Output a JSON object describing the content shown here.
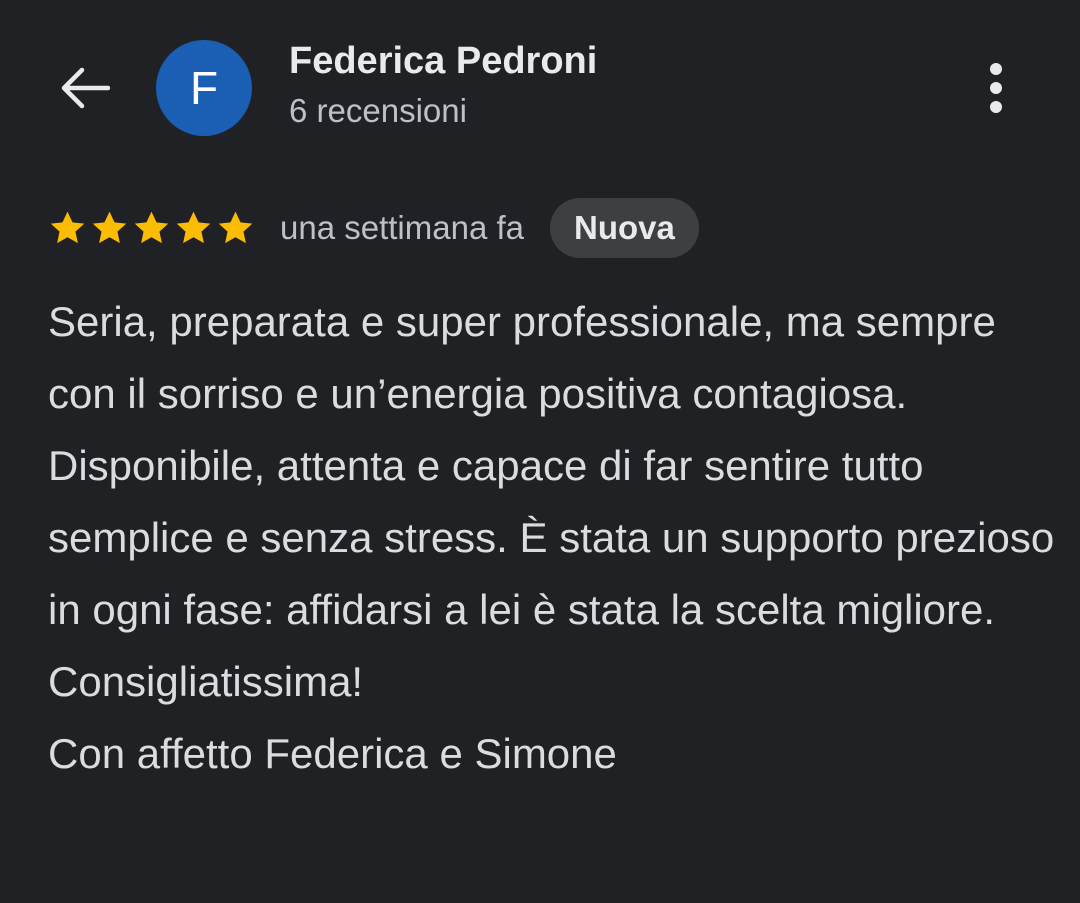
{
  "header": {
    "back_icon": "arrow-back-icon",
    "avatar_initial": "F",
    "avatar_color": "#1a5fb4",
    "reviewer_name": "Federica Pedroni",
    "review_count": "6 recensioni",
    "more_icon": "more-vertical-icon"
  },
  "review": {
    "rating": 5,
    "rating_max": 5,
    "star_color": "#fbbc04",
    "time_ago": "una settimana fa",
    "badge": "Nuova",
    "paragraphs": [
      "Seria, preparata e super professionale, ma sempre con il sorriso e un’energia positiva contagiosa.",
      "Disponibile, attenta e capace di far sentire tutto semplice e senza stress. È stata un supporto prezioso in ogni fase: affidarsi a lei è stata la scelta migliore. Consigliatissima!",
      "Con affetto Federica e Simone"
    ]
  }
}
